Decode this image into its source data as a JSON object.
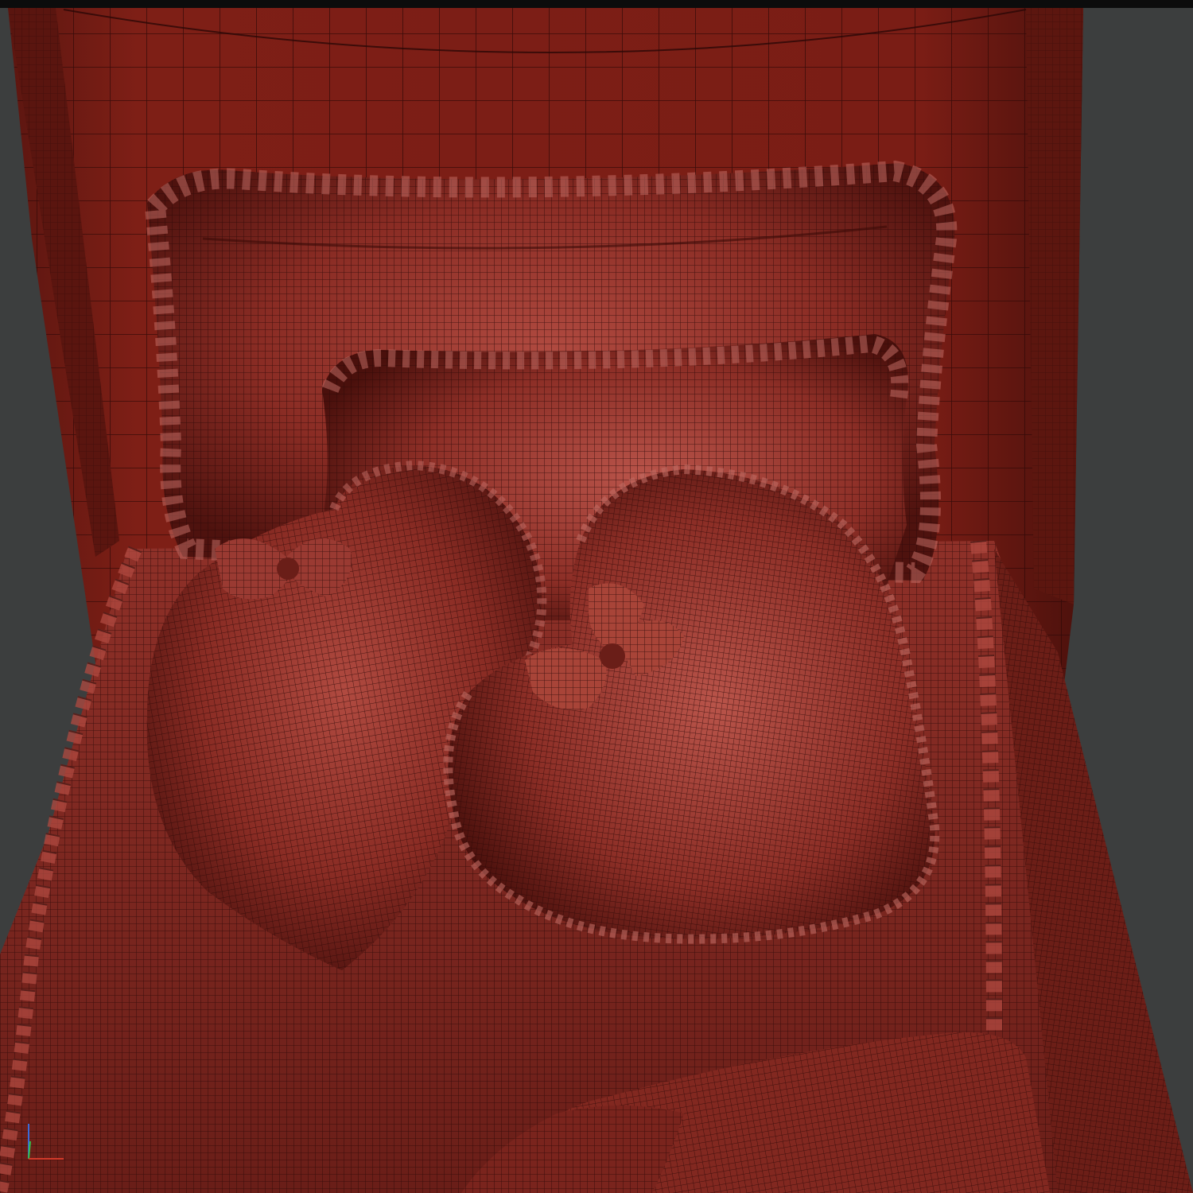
{
  "viewport": {
    "background_color": "#3c3e3e",
    "shading_mode": "wireframe-on-shaded",
    "mesh_color": "#7a1e18",
    "wire_color": "#2a0806",
    "highlight_color": "#c06a62"
  },
  "scene": {
    "objects": [
      {
        "name": "headboard"
      },
      {
        "name": "back-pillow-ruffled"
      },
      {
        "name": "middle-pillow-ruffled"
      },
      {
        "name": "heart-pillow-left"
      },
      {
        "name": "candy-pillow-right"
      },
      {
        "name": "bed-mattress"
      },
      {
        "name": "bedspread-fold"
      }
    ]
  },
  "axis_gizmo": {
    "x_color": "#d23a2a",
    "y_color": "#34c04a",
    "z_color": "#3a6ad8"
  }
}
